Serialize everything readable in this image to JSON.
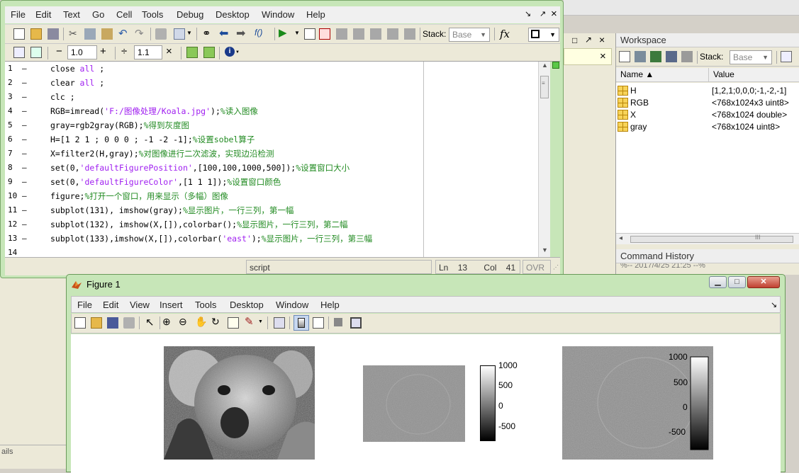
{
  "editor": {
    "menu": [
      "File",
      "Edit",
      "Text",
      "Go",
      "Cell",
      "Tools",
      "Debug",
      "Desktop",
      "Window",
      "Help"
    ],
    "stack_label": "Stack:",
    "stack_value": "Base",
    "fx_label": "fx",
    "cell_minus": "−",
    "cell_value_1": "1.0",
    "cell_plus": "+",
    "cell_divide": "÷",
    "cell_value_2": "1.1",
    "cell_times": "×",
    "line_numbers": [
      "1",
      "2",
      "3",
      "4",
      "5",
      "6",
      "7",
      "8",
      "9",
      "10",
      "11",
      "12",
      "13",
      "14"
    ],
    "code": [
      [
        {
          "t": "close ",
          "c": ""
        },
        {
          "t": "all",
          "c": "str"
        },
        {
          "t": " ;",
          "c": ""
        }
      ],
      [
        {
          "t": "clear ",
          "c": ""
        },
        {
          "t": "all",
          "c": "str"
        },
        {
          "t": " ;",
          "c": ""
        }
      ],
      [
        {
          "t": "clc ;",
          "c": ""
        }
      ],
      [
        {
          "t": "RGB=imread(",
          "c": ""
        },
        {
          "t": "'F:/图像处理/Koala.jpg'",
          "c": "str"
        },
        {
          "t": ");",
          "c": ""
        },
        {
          "t": "%读入图像",
          "c": "cmt"
        }
      ],
      [
        {
          "t": "gray=rgb2gray(RGB);",
          "c": ""
        },
        {
          "t": "%得到灰度图",
          "c": "cmt"
        }
      ],
      [
        {
          "t": "H=[1 2 1 ; 0 0 0 ; -1 -2 -1];",
          "c": ""
        },
        {
          "t": "%设置sobel算子",
          "c": "cmt"
        }
      ],
      [
        {
          "t": "X=filter2(H,gray);",
          "c": ""
        },
        {
          "t": "%对图像进行二次滤波，实现边沿检测",
          "c": "cmt"
        }
      ],
      [
        {
          "t": "set(0,",
          "c": ""
        },
        {
          "t": "'defaultFigurePosition'",
          "c": "str"
        },
        {
          "t": ",[100,100,1000,500]);",
          "c": ""
        },
        {
          "t": "%设置窗口大小",
          "c": "cmt"
        }
      ],
      [
        {
          "t": "set(0,",
          "c": ""
        },
        {
          "t": "'defaultFigureColor'",
          "c": "str"
        },
        {
          "t": ",[1 1 1]);",
          "c": ""
        },
        {
          "t": "%设置窗口颜色",
          "c": "cmt"
        }
      ],
      [
        {
          "t": "figure;",
          "c": ""
        },
        {
          "t": "%打开一个窗口，用来显示（多幅）图像",
          "c": "cmt"
        }
      ],
      [
        {
          "t": "subplot(131), imshow(gray);",
          "c": ""
        },
        {
          "t": "%显示图片，一行三列，第一幅",
          "c": "cmt"
        }
      ],
      [
        {
          "t": "subplot(132), imshow(X,[]),colorbar();",
          "c": ""
        },
        {
          "t": "%显示图片，一行三列，第二幅",
          "c": "cmt"
        }
      ],
      [
        {
          "t": "subplot(133),imshow(X,[]),colorbar(",
          "c": ""
        },
        {
          "t": "'east'",
          "c": "str"
        },
        {
          "t": ");",
          "c": ""
        },
        {
          "t": "%显示图片，一行三列，第三幅",
          "c": "cmt"
        }
      ],
      []
    ],
    "status": {
      "mode": "script",
      "ln_label": "Ln",
      "ln_value": "13",
      "col_label": "Col",
      "col_value": "41",
      "ovr": "OVR"
    }
  },
  "workspace": {
    "title": "Workspace",
    "stack_label": "Stack:",
    "stack_value": "Base",
    "columns": [
      "Name ▲",
      "Value"
    ],
    "rows": [
      {
        "name": "H",
        "value": "[1,2,1;0,0,0;-1,-2,-1]"
      },
      {
        "name": "RGB",
        "value": "<768x1024x3 uint8>"
      },
      {
        "name": "X",
        "value": "<768x1024 double>"
      },
      {
        "name": "gray",
        "value": "<768x1024 uint8>"
      }
    ]
  },
  "command_history": {
    "title": "Command History",
    "partial_line": "%-- 2017/4/25 21:25 --%"
  },
  "background": {
    "left_label": "ails"
  },
  "figure": {
    "title": "Figure 1",
    "menu": [
      "File",
      "Edit",
      "View",
      "Insert",
      "Tools",
      "Desktop",
      "Window",
      "Help"
    ],
    "colorbar1_ticks": [
      "1000",
      "500",
      "0",
      "-500"
    ],
    "colorbar2_ticks": [
      "1000",
      "500",
      "0",
      "-500"
    ]
  },
  "colors": {
    "window_green": "#c7e6b8",
    "keyword": "#0000ff",
    "string": "#a020f0",
    "comment": "#228b22"
  }
}
